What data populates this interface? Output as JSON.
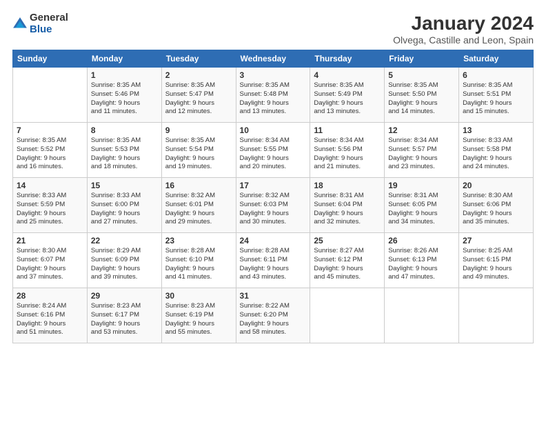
{
  "logo": {
    "general": "General",
    "blue": "Blue"
  },
  "title": "January 2024",
  "location": "Olvega, Castille and Leon, Spain",
  "days_header": [
    "Sunday",
    "Monday",
    "Tuesday",
    "Wednesday",
    "Thursday",
    "Friday",
    "Saturday"
  ],
  "weeks": [
    [
      {
        "num": "",
        "info": ""
      },
      {
        "num": "1",
        "info": "Sunrise: 8:35 AM\nSunset: 5:46 PM\nDaylight: 9 hours\nand 11 minutes."
      },
      {
        "num": "2",
        "info": "Sunrise: 8:35 AM\nSunset: 5:47 PM\nDaylight: 9 hours\nand 12 minutes."
      },
      {
        "num": "3",
        "info": "Sunrise: 8:35 AM\nSunset: 5:48 PM\nDaylight: 9 hours\nand 13 minutes."
      },
      {
        "num": "4",
        "info": "Sunrise: 8:35 AM\nSunset: 5:49 PM\nDaylight: 9 hours\nand 13 minutes."
      },
      {
        "num": "5",
        "info": "Sunrise: 8:35 AM\nSunset: 5:50 PM\nDaylight: 9 hours\nand 14 minutes."
      },
      {
        "num": "6",
        "info": "Sunrise: 8:35 AM\nSunset: 5:51 PM\nDaylight: 9 hours\nand 15 minutes."
      }
    ],
    [
      {
        "num": "7",
        "info": "Sunrise: 8:35 AM\nSunset: 5:52 PM\nDaylight: 9 hours\nand 16 minutes."
      },
      {
        "num": "8",
        "info": "Sunrise: 8:35 AM\nSunset: 5:53 PM\nDaylight: 9 hours\nand 18 minutes."
      },
      {
        "num": "9",
        "info": "Sunrise: 8:35 AM\nSunset: 5:54 PM\nDaylight: 9 hours\nand 19 minutes."
      },
      {
        "num": "10",
        "info": "Sunrise: 8:34 AM\nSunset: 5:55 PM\nDaylight: 9 hours\nand 20 minutes."
      },
      {
        "num": "11",
        "info": "Sunrise: 8:34 AM\nSunset: 5:56 PM\nDaylight: 9 hours\nand 21 minutes."
      },
      {
        "num": "12",
        "info": "Sunrise: 8:34 AM\nSunset: 5:57 PM\nDaylight: 9 hours\nand 23 minutes."
      },
      {
        "num": "13",
        "info": "Sunrise: 8:33 AM\nSunset: 5:58 PM\nDaylight: 9 hours\nand 24 minutes."
      }
    ],
    [
      {
        "num": "14",
        "info": "Sunrise: 8:33 AM\nSunset: 5:59 PM\nDaylight: 9 hours\nand 25 minutes."
      },
      {
        "num": "15",
        "info": "Sunrise: 8:33 AM\nSunset: 6:00 PM\nDaylight: 9 hours\nand 27 minutes."
      },
      {
        "num": "16",
        "info": "Sunrise: 8:32 AM\nSunset: 6:01 PM\nDaylight: 9 hours\nand 29 minutes."
      },
      {
        "num": "17",
        "info": "Sunrise: 8:32 AM\nSunset: 6:03 PM\nDaylight: 9 hours\nand 30 minutes."
      },
      {
        "num": "18",
        "info": "Sunrise: 8:31 AM\nSunset: 6:04 PM\nDaylight: 9 hours\nand 32 minutes."
      },
      {
        "num": "19",
        "info": "Sunrise: 8:31 AM\nSunset: 6:05 PM\nDaylight: 9 hours\nand 34 minutes."
      },
      {
        "num": "20",
        "info": "Sunrise: 8:30 AM\nSunset: 6:06 PM\nDaylight: 9 hours\nand 35 minutes."
      }
    ],
    [
      {
        "num": "21",
        "info": "Sunrise: 8:30 AM\nSunset: 6:07 PM\nDaylight: 9 hours\nand 37 minutes."
      },
      {
        "num": "22",
        "info": "Sunrise: 8:29 AM\nSunset: 6:09 PM\nDaylight: 9 hours\nand 39 minutes."
      },
      {
        "num": "23",
        "info": "Sunrise: 8:28 AM\nSunset: 6:10 PM\nDaylight: 9 hours\nand 41 minutes."
      },
      {
        "num": "24",
        "info": "Sunrise: 8:28 AM\nSunset: 6:11 PM\nDaylight: 9 hours\nand 43 minutes."
      },
      {
        "num": "25",
        "info": "Sunrise: 8:27 AM\nSunset: 6:12 PM\nDaylight: 9 hours\nand 45 minutes."
      },
      {
        "num": "26",
        "info": "Sunrise: 8:26 AM\nSunset: 6:13 PM\nDaylight: 9 hours\nand 47 minutes."
      },
      {
        "num": "27",
        "info": "Sunrise: 8:25 AM\nSunset: 6:15 PM\nDaylight: 9 hours\nand 49 minutes."
      }
    ],
    [
      {
        "num": "28",
        "info": "Sunrise: 8:24 AM\nSunset: 6:16 PM\nDaylight: 9 hours\nand 51 minutes."
      },
      {
        "num": "29",
        "info": "Sunrise: 8:23 AM\nSunset: 6:17 PM\nDaylight: 9 hours\nand 53 minutes."
      },
      {
        "num": "30",
        "info": "Sunrise: 8:23 AM\nSunset: 6:19 PM\nDaylight: 9 hours\nand 55 minutes."
      },
      {
        "num": "31",
        "info": "Sunrise: 8:22 AM\nSunset: 6:20 PM\nDaylight: 9 hours\nand 58 minutes."
      },
      {
        "num": "",
        "info": ""
      },
      {
        "num": "",
        "info": ""
      },
      {
        "num": "",
        "info": ""
      }
    ]
  ]
}
